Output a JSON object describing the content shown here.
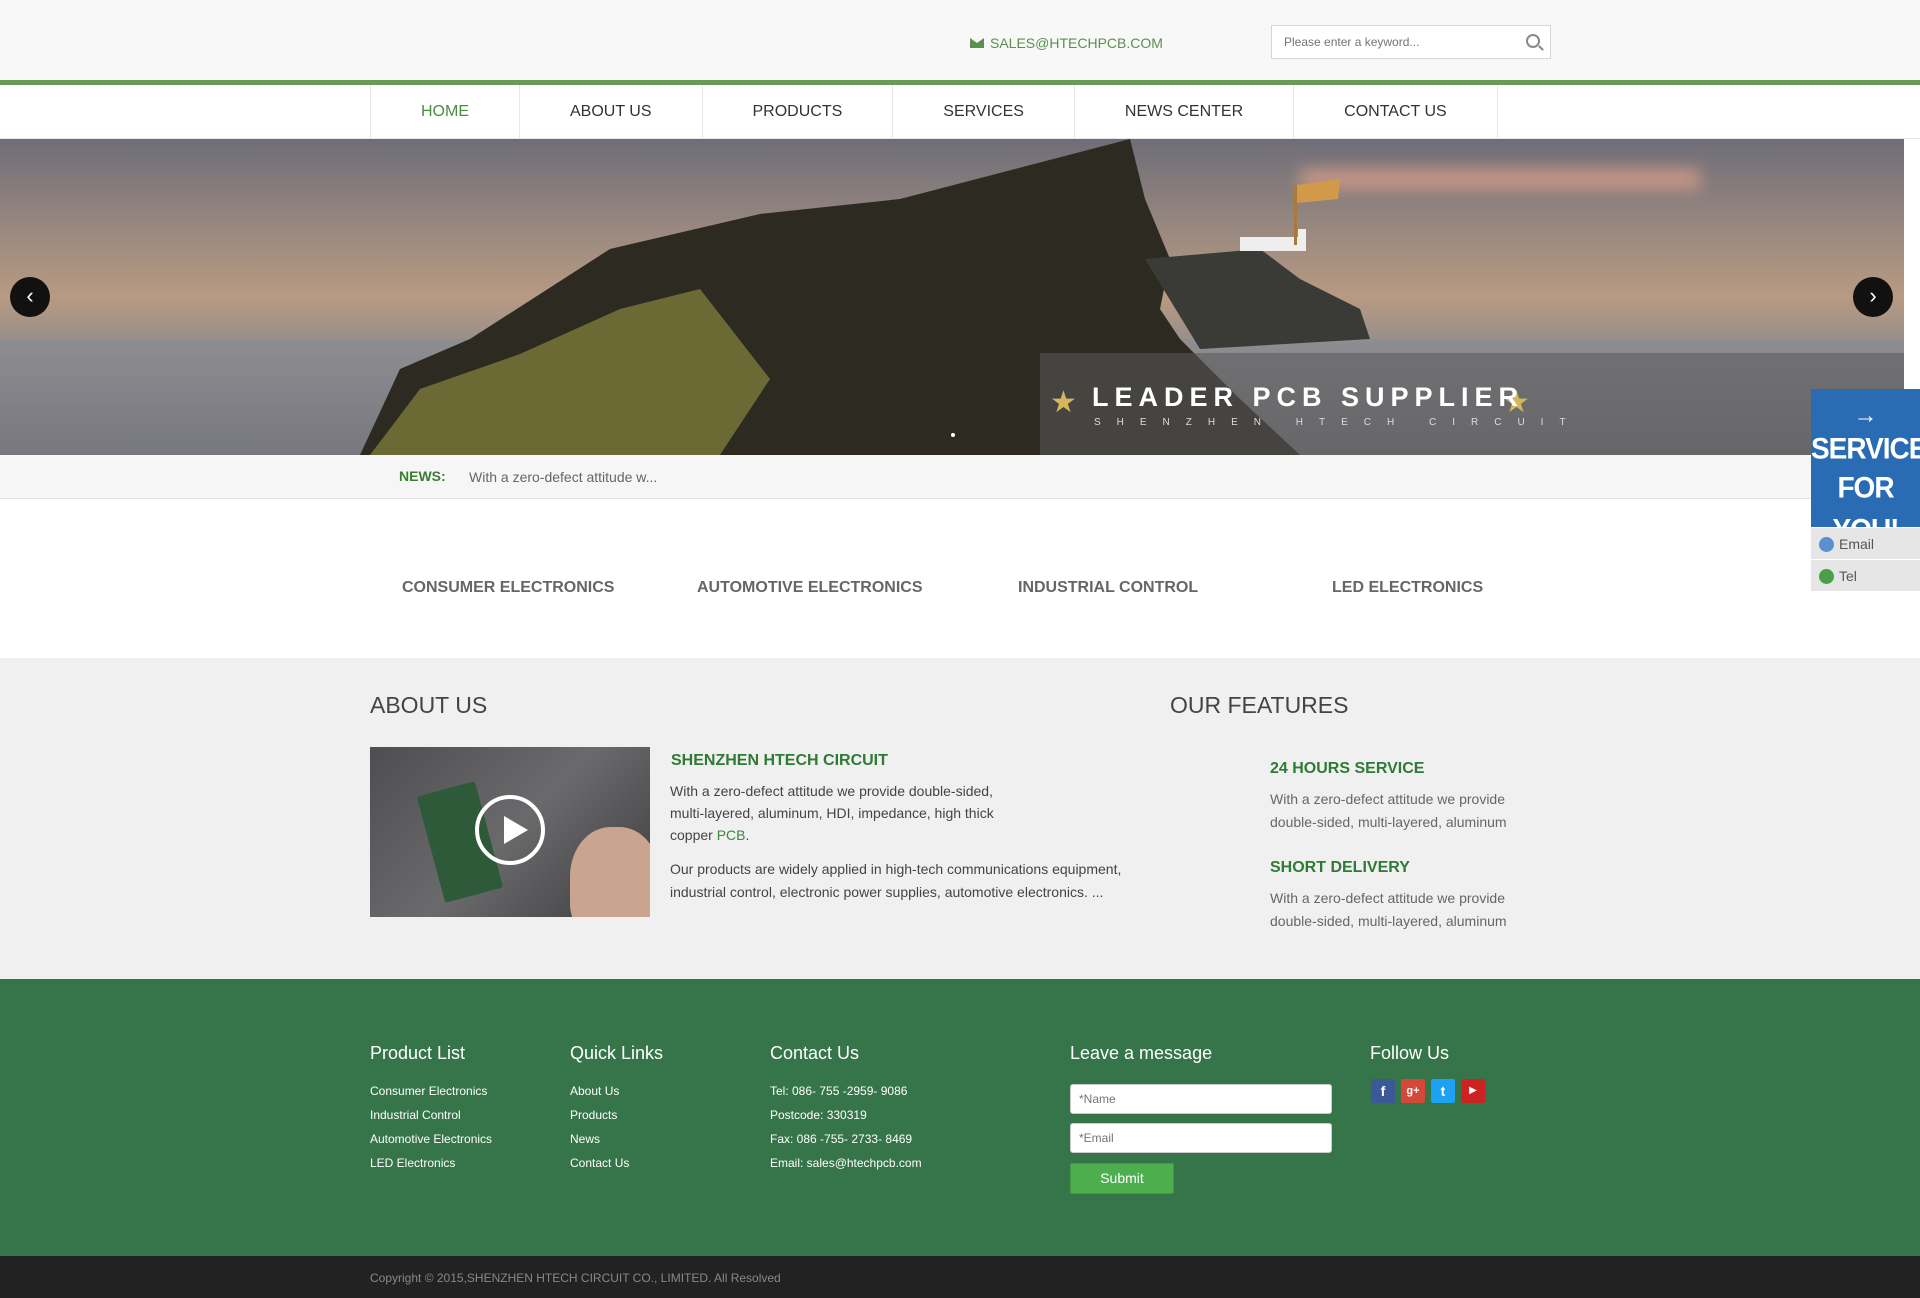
{
  "header": {
    "email": "SALES@HTECHPCB.COM",
    "search_placeholder": "Please enter a keyword..."
  },
  "nav": [
    "HOME",
    "ABOUT US",
    "PRODUCTS",
    "SERVICES",
    "NEWS CENTER",
    "CONTACT US"
  ],
  "banner": {
    "caption": "LEADER PCB SUPPLIER",
    "subcaption": "SHENZHEN HTECH CIRCUIT"
  },
  "news": {
    "label": "NEWS:",
    "text": "With a zero-defect attitude w..."
  },
  "categories": [
    "CONSUMER ELECTRONICS",
    "AUTOMOTIVE ELECTRONICS",
    "INDUSTRIAL CONTROL",
    "LED ELECTRONICS"
  ],
  "about": {
    "title": "ABOUT US",
    "company": "SHENZHEN HTECH CIRCUIT",
    "p1_a": "With a zero-defect attitude we provide double-sided, multi-layered, aluminum, HDI, impedance, high thick copper ",
    "p1_link": "PCB",
    "p1_end": ".",
    "p2": "Our products are widely applied in high-tech communications equipment, industrial control, electronic power supplies, automotive electronics. ..."
  },
  "features": {
    "title": "OUR FEATURES",
    "items": [
      {
        "title": "24 HOURS SERVICE",
        "desc": "With a zero-defect attitude we provide double-sided, multi-layered, aluminum"
      },
      {
        "title": "SHORT DELIVERY",
        "desc": "With a zero-defect attitude we provide double-sided, multi-layered, aluminum"
      }
    ]
  },
  "footer": {
    "product_list": {
      "title": "Product List",
      "items": [
        "Consumer Electronics",
        "Industrial Control",
        "Automotive Electronics",
        "LED Electronics"
      ]
    },
    "quick_links": {
      "title": "Quick Links",
      "items": [
        "About Us",
        "Products",
        "News",
        "Contact Us"
      ]
    },
    "contact": {
      "title": "Contact Us",
      "items": [
        "Tel:  086- 755 -2959- 9086",
        "Postcode:  330319",
        "Fax:  086 -755- 2733- 8469",
        "Email:  sales@htechpcb.com"
      ]
    },
    "message": {
      "title": "Leave a message",
      "name_placeholder": "*Name",
      "email_placeholder": "*Email",
      "submit": "Submit"
    },
    "follow": {
      "title": "Follow Us",
      "icons": [
        "facebook-icon",
        "google-plus-icon",
        "twitter-icon",
        "youtube-icon"
      ]
    }
  },
  "copyright": "Copyright © 2015,SHENZHEN HTECH CIRCUIT CO., LIMITED. All Resolved",
  "side_widget": {
    "line1": "SERVICE",
    "line2": "FOR YOU!",
    "email": "Email",
    "tel": "Tel"
  },
  "colors": {
    "brand_green": "#367549",
    "accent_green": "#2f7a35",
    "widget_blue": "#2a6cb4"
  }
}
